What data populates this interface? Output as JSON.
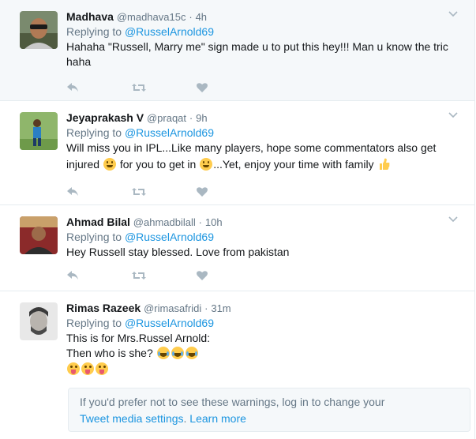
{
  "tweets": [
    {
      "fullname": "Madhava",
      "username": "@madhava15c",
      "dot": "·",
      "time": "4h",
      "replying_prefix": "Replying to",
      "replying_to": "@RusselArnold69",
      "text_line1": "Hahaha \"Russell, Marry me\" sign made u to put this hey!!! Man u know the tric",
      "text_line2": "haha"
    },
    {
      "fullname": "Jeyaprakash V",
      "username": "@praqat",
      "dot": "·",
      "time": "9h",
      "replying_prefix": "Replying to",
      "replying_to": "@RusselArnold69",
      "text_line1": "Will miss you in IPL...Like many players, hope some commentators also get",
      "text_line2_a": "injured",
      "text_line2_b": "for you to get in",
      "text_line2_c": "...Yet, enjoy your time with family"
    },
    {
      "fullname": "Ahmad Bilal",
      "username": "@ahmadbilall",
      "dot": "·",
      "time": "10h",
      "replying_prefix": "Replying to",
      "replying_to": "@RusselArnold69",
      "text_line1": "Hey Russell stay blessed. Love from pakistan"
    },
    {
      "fullname": "Rimas Razeek",
      "username": "@rimasafridi",
      "dot": "·",
      "time": "31m",
      "replying_prefix": "Replying to",
      "replying_to": "@RusselArnold69",
      "text_line1": "This is for Mrs.Russel Arnold:",
      "text_line2": "Then who is she?"
    }
  ],
  "warning": {
    "line1": "If you'd prefer not to see these warnings, log in to change your",
    "link1": "Tweet media settings",
    "separator": ".",
    "link2": "Learn more"
  },
  "icons": {
    "reply": "reply-icon",
    "retweet": "retweet-icon",
    "like": "heart-icon",
    "more": "chevron-down-icon"
  },
  "colors": {
    "link": "#1b95e0",
    "muted": "#657786",
    "action_icon": "#aab8c2",
    "highlight_bg": "#f5f8fa"
  }
}
